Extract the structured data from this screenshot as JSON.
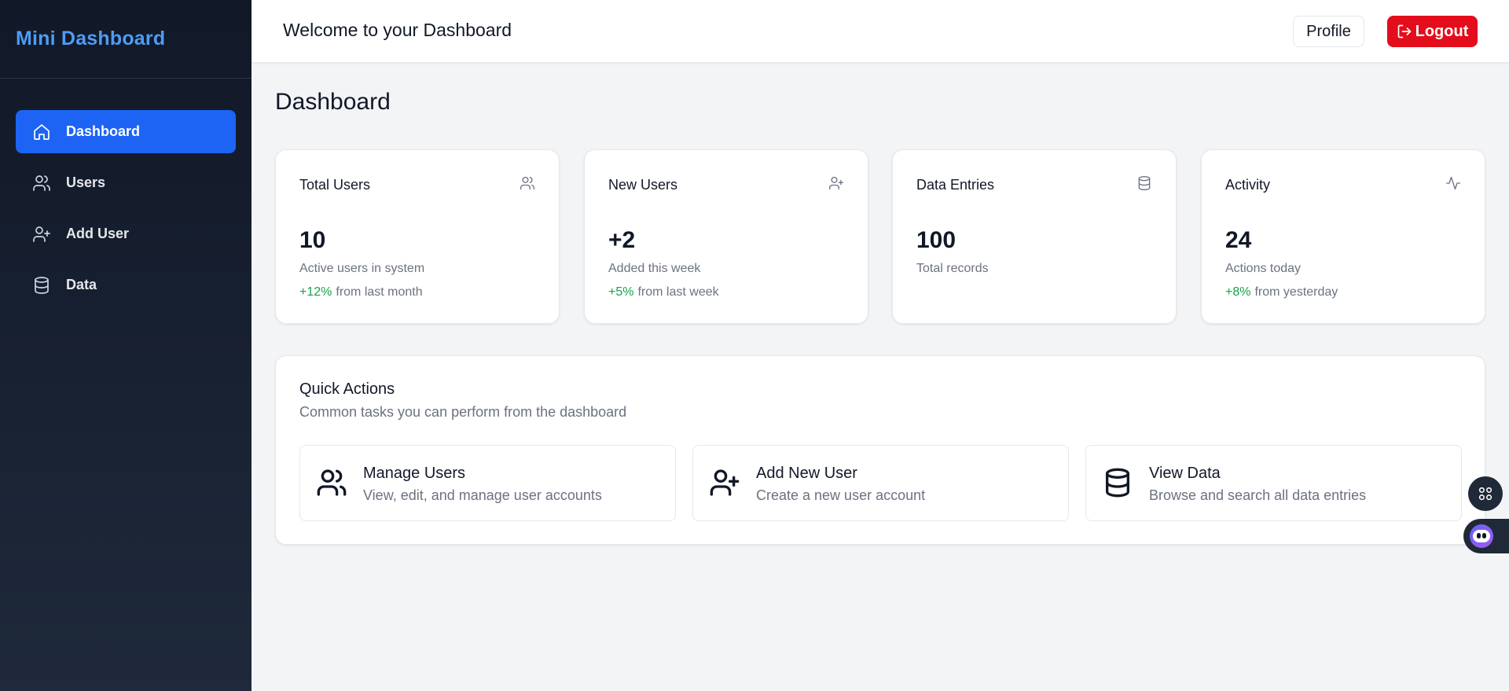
{
  "sidebar": {
    "brand": "Mini Dashboard",
    "items": [
      {
        "label": "Dashboard",
        "icon": "home-icon",
        "active": true
      },
      {
        "label": "Users",
        "icon": "users-icon",
        "active": false
      },
      {
        "label": "Add User",
        "icon": "user-plus-icon",
        "active": false
      },
      {
        "label": "Data",
        "icon": "database-icon",
        "active": false
      }
    ]
  },
  "header": {
    "welcome": "Welcome to your Dashboard",
    "profile_label": "Profile",
    "logout_label": "Logout"
  },
  "main": {
    "title": "Dashboard",
    "stats": [
      {
        "title": "Total Users",
        "icon": "users-icon",
        "value": "10",
        "desc": "Active users in system",
        "trend": "+12%",
        "trend_text": "from last month"
      },
      {
        "title": "New Users",
        "icon": "user-plus-icon",
        "value": "+2",
        "desc": "Added this week",
        "trend": "+5%",
        "trend_text": "from last week"
      },
      {
        "title": "Data Entries",
        "icon": "database-icon",
        "value": "100",
        "desc": "Total records"
      },
      {
        "title": "Activity",
        "icon": "activity-icon",
        "value": "24",
        "desc": "Actions today",
        "trend": "+8%",
        "trend_text": "from yesterday"
      }
    ],
    "quick_actions": {
      "title": "Quick Actions",
      "subtitle": "Common tasks you can perform from the dashboard",
      "items": [
        {
          "title": "Manage Users",
          "desc": "View, edit, and manage user accounts",
          "icon": "users-icon"
        },
        {
          "title": "Add New User",
          "desc": "Create a new user account",
          "icon": "user-plus-icon"
        },
        {
          "title": "View Data",
          "desc": "Browse and search all data entries",
          "icon": "database-icon"
        }
      ]
    }
  },
  "colors": {
    "sidebar_bg": "#111827",
    "brand": "#4f9bf5",
    "active_nav": "#1d64f5",
    "logout": "#e30d1b",
    "trend_positive": "#16a34a"
  }
}
